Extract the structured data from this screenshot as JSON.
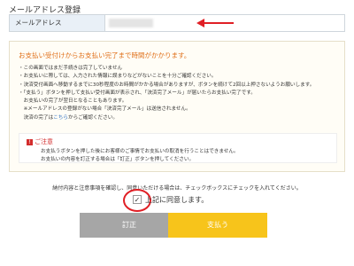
{
  "section": {
    "title": "メールアドレス登録"
  },
  "email": {
    "label": "メールアドレス",
    "value": ""
  },
  "notice": {
    "heading": "お支払い受付けからお支払い完了まで時間がかかります。",
    "items": [
      "・この画面ではまだ手続きは完了していません",
      "・お支払いに際しては、入力された情報に誤まりなどがないことを十分ご確認ください。",
      "・決済受付画面へ移動するまでに30秒程度のお時間がかかる場合がありますが、ボタンを続けて2回以上押さないようお願いします。",
      "・「支払う」ボタンを押して支払い受付画面が表示され、「決済完了メール」が届いたらお支払い完了です。",
      "　お支払いの完了が翌日となることもあります。",
      "　※メールアドレスの登録がない場合「決済完了メール」は送信されません。"
    ],
    "last_prefix": "　決済の完了は",
    "last_link": "こちら",
    "last_suffix": "からご確認ください。"
  },
  "caution": {
    "badge": "!",
    "title": "ご注意",
    "lines": [
      "お支払うボタンを押した後にお客様のご事情でお支払いの取消を行うことはできません。",
      "お支払いの内容を訂正する場合は「訂正」ボタンを押してください。"
    ]
  },
  "consent": {
    "text": "納付内容と注意事項を確認し、同意いただける場合は、チェックボックスにチェックを入れてください。",
    "checkbox_label": "上記に同意します。",
    "checked": true
  },
  "buttons": {
    "correct": "訂正",
    "pay": "支払う"
  },
  "colors": {
    "accent_orange": "#e0701a",
    "caution_red": "#d32d2d",
    "pay_yellow": "#f7c41b",
    "correct_gray": "#a6a6a6"
  }
}
